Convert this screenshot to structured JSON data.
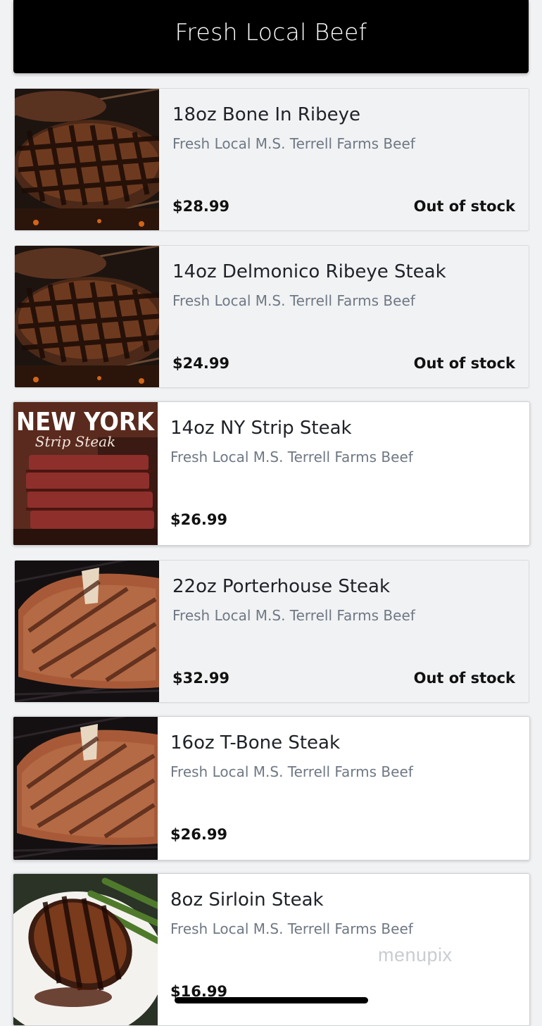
{
  "header": {
    "title": "Fresh Local Beef"
  },
  "items": [
    {
      "name": "18oz Bone In Ribeye",
      "description": "Fresh Local M.S. Terrell Farms Beef",
      "price": "$28.99",
      "stock": "Out of stock",
      "image": "ribeye"
    },
    {
      "name": "14oz Delmonico Ribeye Steak",
      "description": "Fresh Local M.S. Terrell Farms Beef",
      "price": "$24.99",
      "stock": "Out of stock",
      "image": "ribeye"
    },
    {
      "name": "14oz NY Strip Steak",
      "description": "Fresh Local M.S. Terrell Farms Beef",
      "price": "$26.99",
      "stock": "",
      "image": "nystrip",
      "image_text_1": "NEW YORK",
      "image_text_2": "Strip Steak"
    },
    {
      "name": "22oz Porterhouse Steak",
      "description": "Fresh Local M.S. Terrell Farms Beef",
      "price": "$32.99",
      "stock": "Out of stock",
      "image": "tbone"
    },
    {
      "name": "16oz T-Bone Steak",
      "description": "Fresh Local M.S. Terrell Farms Beef",
      "price": "$26.99",
      "stock": "",
      "image": "tbone"
    },
    {
      "name": "8oz Sirloin Steak",
      "description": "Fresh Local M.S. Terrell Farms Beef",
      "price": "$16.99",
      "stock": "",
      "image": "sirloin"
    }
  ],
  "watermark": "menupix",
  "colors": {
    "header_bg": "#000000",
    "card_unavailable": "#f1f2f4",
    "card_available": "#ffffff"
  }
}
